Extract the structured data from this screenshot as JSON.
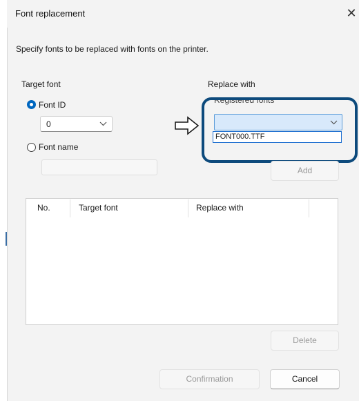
{
  "dialog": {
    "title": "Font replacement",
    "close_glyph": "✕",
    "instruction": "Specify fonts to be replaced with fonts on the printer."
  },
  "target": {
    "heading": "Target font",
    "font_id_label": "Font ID",
    "font_id_value": "0",
    "font_name_label": "Font name",
    "font_name_value": ""
  },
  "arrow_glyph": "⇨",
  "replace": {
    "heading": "Replace with",
    "registered_label": "Registered fonts",
    "registered_value": "",
    "options": [
      "FONT000.TTF"
    ],
    "add_label": "Add"
  },
  "table": {
    "columns": [
      "No.",
      "Target font",
      "Replace with"
    ],
    "rows": []
  },
  "buttons": {
    "delete": "Delete",
    "confirmation": "Confirmation",
    "cancel": "Cancel"
  },
  "colors": {
    "accent": "#0067c0",
    "highlight_outline": "#0d4a7c"
  }
}
